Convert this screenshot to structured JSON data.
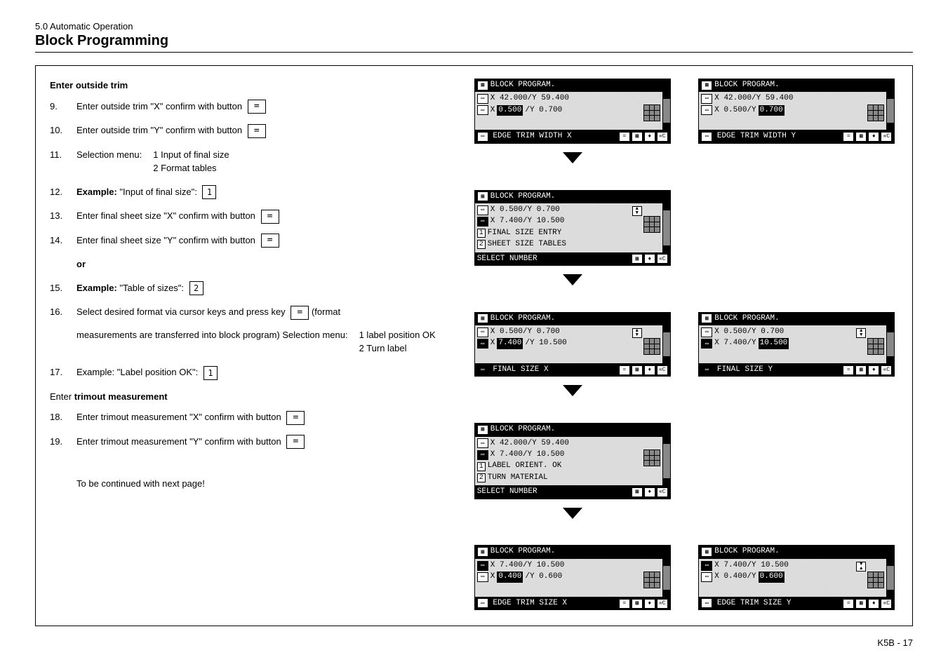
{
  "header": {
    "section_number": "5.0 Automatic Operation",
    "title": "Block Programming"
  },
  "instructions": {
    "enter_outside_trim": "Enter outside trim",
    "items": [
      {
        "num": "9.",
        "text": "Enter outside trim \"X\" confirm with button",
        "has_confirm": true
      },
      {
        "num": "10.",
        "text": "Enter outside trim \"Y\" confirm with button",
        "has_confirm": true
      },
      {
        "num": "11.",
        "text": "Selection menu:",
        "sub": [
          "1 Input of final size",
          "2 Format tables"
        ]
      },
      {
        "num": "12.",
        "prefix_bold": "Example: ",
        "text_after": "\"Input of final size\":",
        "numkey": "1"
      },
      {
        "num": "13.",
        "text": "Enter final sheet size \"X\" confirm with button",
        "has_confirm": true
      },
      {
        "num": "14.",
        "text": "Enter final sheet size \"Y\" confirm with button",
        "has_confirm": true
      }
    ],
    "or": "or",
    "item15": {
      "num": "15.",
      "prefix_bold": "Example: ",
      "text_after": "\"Table of sizes\":",
      "numkey": "2"
    },
    "item16": {
      "num": "16.",
      "line1a": "Select desired format via cursor keys and press key",
      "line1b": "(format",
      "line2": "measurements are transferred into block program)",
      "menu_label": "Selection menu:",
      "menu_opts": [
        "1 label position OK",
        "2 Turn label"
      ]
    },
    "item17": {
      "num": "17.",
      "text": "Example: \"Label position OK\":",
      "numkey": "1"
    },
    "enter_trimout": "Enter trimout measurement",
    "item18": {
      "num": "18.",
      "text": "Enter trimout measurement \"X\" confirm with button",
      "has_confirm": true
    },
    "item19": {
      "num": "19.",
      "text": "Enter trimout measurement \"Y\" confirm with button",
      "has_confirm": true
    },
    "continue": "To be continued with next page!"
  },
  "lcd": {
    "title": "BLOCK PROGRAM.",
    "panel1": {
      "row1": "X 42.000/Y 59.400",
      "row2a": "X",
      "row2b_hl": " 0.500",
      "row2c": "/Y  0.700",
      "footer": "EDGE TRIM WIDTH X"
    },
    "panel1b": {
      "row1": "X 42.000/Y 59.400",
      "row2a": "X  0.500/Y",
      "row2b_hl": " 0.700",
      "footer": "EDGE TRIM WIDTH Y"
    },
    "panel2": {
      "row1": "X  0.500/Y  0.700",
      "row2": "X  7.400/Y 10.500",
      "opt1": "FINAL SIZE ENTRY",
      "opt2": "SHEET SIZE TABLES",
      "footer": "SELECT NUMBER"
    },
    "panel3": {
      "row1": "X  0.500/Y  0.700",
      "row2a": "X",
      "row2b_hl": " 7.400",
      "row2c": "/Y 10.500",
      "footer": "FINAL SIZE X"
    },
    "panel3b": {
      "row1": "X  0.500/Y  0.700",
      "row2a": "X  7.400/Y",
      "row2b_hl": " 10.500",
      "footer": "FINAL SIZE Y"
    },
    "panel4": {
      "row1": "X 42.000/Y 59.400",
      "row2": "X  7.400/Y 10.500",
      "opt1": "LABEL ORIENT. OK",
      "opt2": "TURN MATERIAL",
      "footer": "SELECT NUMBER"
    },
    "panel5": {
      "row1": "X  7.400/Y 10.500",
      "row2a": "X",
      "row2b_hl": " 0.400",
      "row2c": "/Y  0.600",
      "footer": "EDGE TRIM SIZE X"
    },
    "panel5b": {
      "row1": "X  7.400/Y 10.500",
      "row2a": "X  0.400/Y",
      "row2b_hl": " 0.600",
      "footer": "EDGE TRIM SIZE Y"
    }
  },
  "footer": "K5B - 17"
}
